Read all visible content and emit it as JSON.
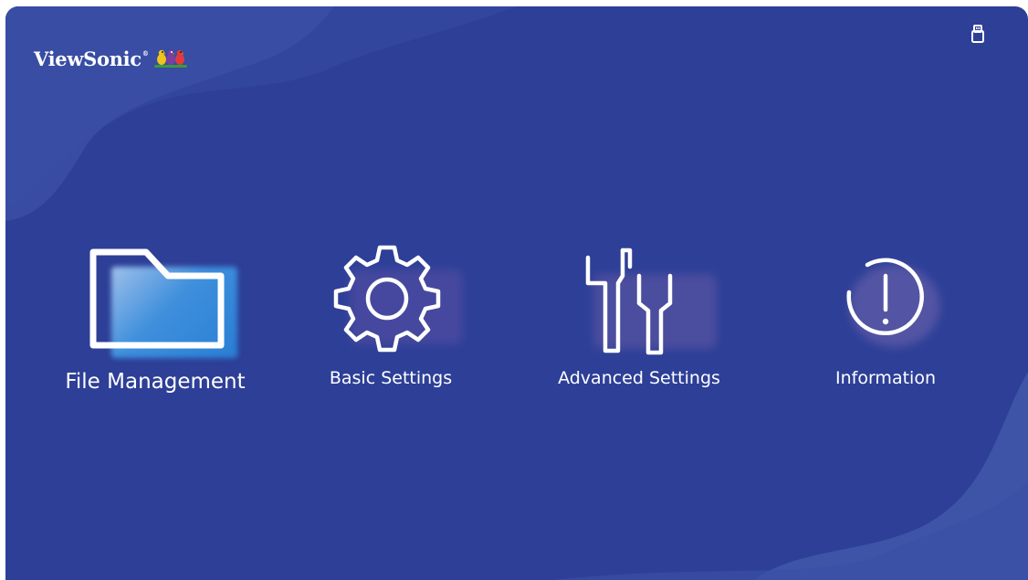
{
  "brand": {
    "name": "ViewSonic",
    "trademark": "®"
  },
  "status": {
    "storage_icon": "usb-drive-icon"
  },
  "menu": {
    "items": [
      {
        "label": "File Management",
        "icon": "folder-icon",
        "selected": true
      },
      {
        "label": "Basic Settings",
        "icon": "gear-icon",
        "selected": false
      },
      {
        "label": "Advanced Settings",
        "icon": "tools-icon",
        "selected": false
      },
      {
        "label": "Information",
        "icon": "info-icon",
        "selected": false
      }
    ]
  },
  "colors": {
    "background": "#2d3f97",
    "wave_light": "#3f55a7",
    "accent_blue": "#2f86d6",
    "icon_stroke": "#ffffff"
  }
}
